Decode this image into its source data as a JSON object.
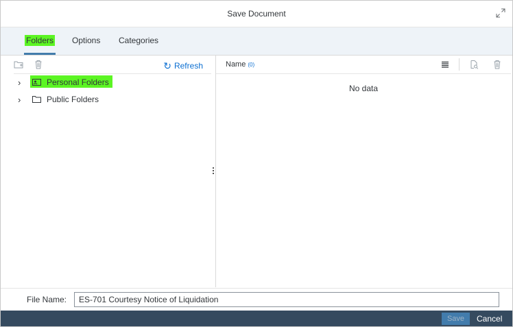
{
  "dialog": {
    "title": "Save Document"
  },
  "tabs": [
    {
      "label": "Folders",
      "selected": true
    },
    {
      "label": "Options"
    },
    {
      "label": "Categories"
    }
  ],
  "left_toolbar": {
    "refresh_label": "Refresh"
  },
  "tree": [
    {
      "label": "Personal Folders",
      "icon": "personal-folder-icon",
      "highlighted": true
    },
    {
      "label": "Public Folders",
      "icon": "folder-icon"
    }
  ],
  "list": {
    "column_name": "Name",
    "count": "(0)",
    "empty_text": "No data"
  },
  "file": {
    "label": "File Name:",
    "value": "ES-701 Courtesy Notice of Liquidation"
  },
  "footer": {
    "save_label": "Save",
    "cancel_label": "Cancel"
  },
  "colors": {
    "highlight": "#5cf523",
    "accent": "#0a6ed1",
    "footer_bg": "#354a5f",
    "tab_bg": "#eef3f8"
  }
}
